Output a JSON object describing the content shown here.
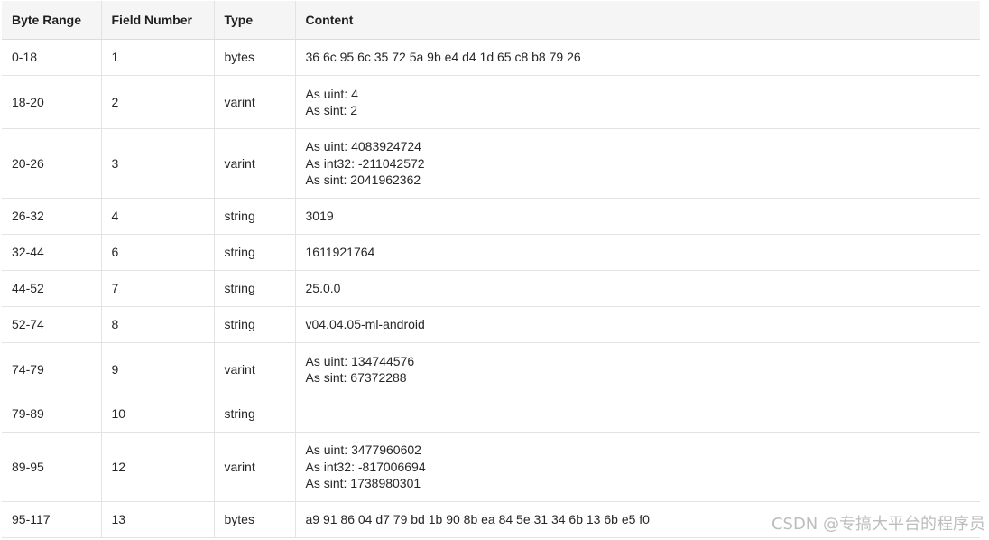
{
  "table": {
    "headers": [
      "Byte Range",
      "Field Number",
      "Type",
      "Content"
    ],
    "rows": [
      {
        "range": "0-18",
        "field": "1",
        "type": "bytes",
        "content": [
          "36 6c 95 6c 35 72 5a 9b e4 d4 1d 65 c8 b8 79 26"
        ]
      },
      {
        "range": "18-20",
        "field": "2",
        "type": "varint",
        "content": [
          "As uint: 4",
          "As sint: 2"
        ]
      },
      {
        "range": "20-26",
        "field": "3",
        "type": "varint",
        "content": [
          "As uint: 4083924724",
          "As int32: -211042572",
          "As sint: 2041962362"
        ]
      },
      {
        "range": "26-32",
        "field": "4",
        "type": "string",
        "content": [
          "3019"
        ]
      },
      {
        "range": "32-44",
        "field": "6",
        "type": "string",
        "content": [
          "1611921764"
        ]
      },
      {
        "range": "44-52",
        "field": "7",
        "type": "string",
        "content": [
          "25.0.0"
        ]
      },
      {
        "range": "52-74",
        "field": "8",
        "type": "string",
        "content": [
          "v04.04.05-ml-android"
        ]
      },
      {
        "range": "74-79",
        "field": "9",
        "type": "varint",
        "content": [
          "As uint: 134744576",
          "As sint: 67372288"
        ]
      },
      {
        "range": "79-89",
        "field": "10",
        "type": "string",
        "content": []
      },
      {
        "range": "89-95",
        "field": "12",
        "type": "varint",
        "content": [
          "As uint: 3477960602",
          "As int32: -817006694",
          "As sint: 1738980301"
        ]
      },
      {
        "range": "95-117",
        "field": "13",
        "type": "bytes",
        "content": [
          "a9 91 86 04 d7 79 bd 1b 90 8b ea 84 5e 31 34 6b 13 6b e5 f0"
        ]
      }
    ]
  },
  "watermark": "CSDN @专搞大平台的程序员"
}
